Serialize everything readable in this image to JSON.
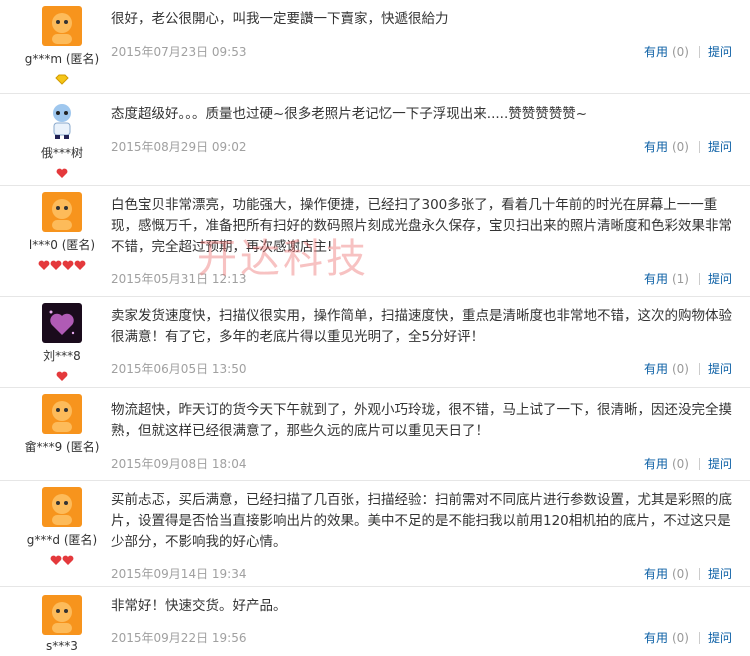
{
  "reviews": [
    {
      "user": "g***m (匿名)",
      "text": "很好，老公很開心，叫我一定要讚一下賣家，快遞很給力",
      "date": "2015年07月23日 09:53",
      "useful_label": "有用",
      "useful_count": "(0)",
      "reply_label": "提问",
      "avatar": "taobao-mascot-avatar",
      "badge": "diamond-gold",
      "badge_count": 1
    },
    {
      "user": "俄***树",
      "text": "态度超级好。。。质量也过硬~很多老照片老记忆一下子浮现出来.....赞赞赞赞赞~",
      "date": "2015年08月29日 09:02",
      "useful_label": "有用",
      "useful_count": "(0)",
      "reply_label": "提问",
      "avatar": "cartoon-character-avatar",
      "badge": "heart-red",
      "badge_count": 1
    },
    {
      "user": "l***0 (匿名)",
      "text": "白色宝贝非常漂亮，功能强大，操作便捷，已经扫了300多张了，看着几十年前的时光在屏幕上一一重现，感慨万千，准备把所有扫好的数码照片刻成光盘永久保存，宝贝扫出来的照片清晰度和色彩效果非常不错，完全超过预期，再次感谢店主!",
      "date": "2015年05月31日 12:13",
      "useful_label": "有用",
      "useful_count": "(1)",
      "reply_label": "提问",
      "avatar": "taobao-mascot-avatar",
      "badge": "heart-red",
      "badge_count": 4
    },
    {
      "user": "刘***8",
      "text": "卖家发货速度快，扫描仪很实用，操作简单，扫描速度快，重点是清晰度也非常地不错，这次的购物体验很满意！有了它，多年的老底片得以重见光明了，全5分好评！",
      "date": "2015年06月05日 13:50",
      "useful_label": "有用",
      "useful_count": "(0)",
      "reply_label": "提问",
      "avatar": "purple-heart-avatar",
      "badge": "heart-red",
      "badge_count": 1
    },
    {
      "user": "畲***9 (匿名)",
      "text": "物流超快，昨天订的货今天下午就到了，外观小巧玲珑，很不错，马上试了一下，很清晰，因还没完全摸熟，但就这样已经很满意了，那些久远的底片可以重见天日了！",
      "date": "2015年09月08日 18:04",
      "useful_label": "有用",
      "useful_count": "(0)",
      "reply_label": "提问",
      "avatar": "taobao-mascot-avatar",
      "badge": "none",
      "badge_count": 0
    },
    {
      "user": "g***d (匿名)",
      "text": "买前忐忑，买后满意，已经扫描了几百张，扫描经验：扫前需对不同底片进行参数设置，尤其是彩照的底片，设置得是否恰当直接影响出片的效果。美中不足的是不能扫我以前用120相机拍的底片，不过这只是少部分，不影响我的好心情。",
      "date": "2015年09月14日 19:34",
      "useful_label": "有用",
      "useful_count": "(0)",
      "reply_label": "提问",
      "avatar": "taobao-mascot-avatar",
      "badge": "heart-red",
      "badge_count": 2
    },
    {
      "user": "s***3",
      "text": "非常好！快速交货。好产品。",
      "date": "2015年09月22日 19:56",
      "useful_label": "有用",
      "useful_count": "(0)",
      "reply_label": "提问",
      "avatar": "taobao-mascot-avatar",
      "badge": "none",
      "badge_count": 0
    }
  ],
  "watermark": "开达科技",
  "colors": {
    "link": "#0b5fa5",
    "date": "#a0a0a0",
    "mascot": "#f7941d",
    "badge_heart": "#e4393c",
    "badge_diamond": "#f5c518"
  }
}
